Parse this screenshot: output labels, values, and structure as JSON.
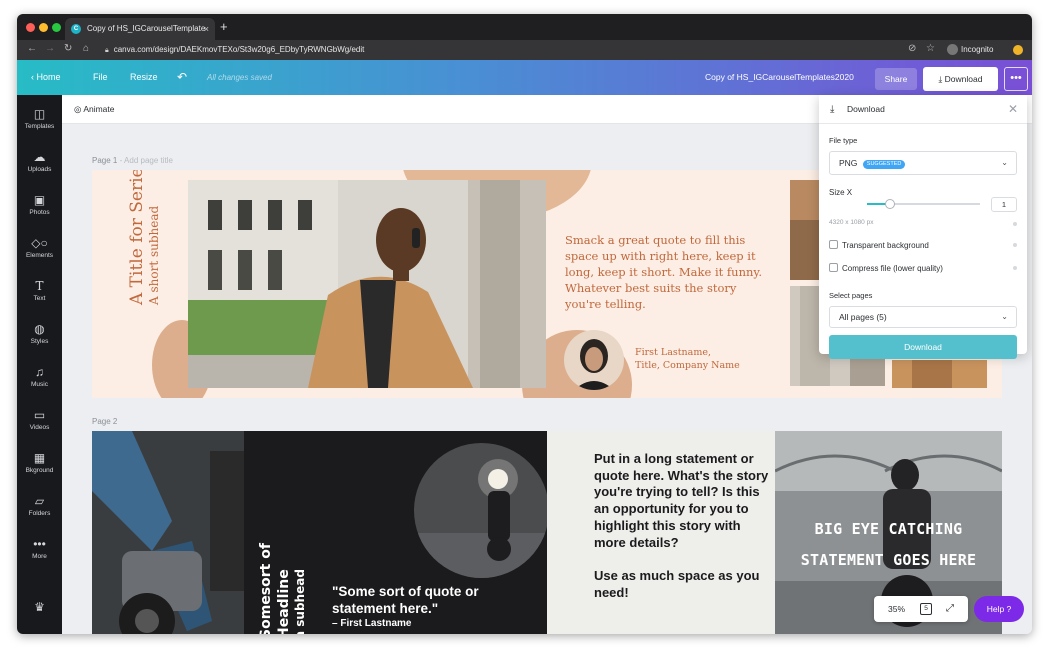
{
  "browser": {
    "tab_title": "Copy of HS_IGCarouselTemplate",
    "tab_close": "×",
    "new_tab": "+",
    "url": "canva.com/design/DAEKmovTEXo/St3w20g6_EDbyTyRWNGbWg/edit",
    "incognito_label": "Incognito"
  },
  "toolbar": {
    "home_label": "Home",
    "file_label": "File",
    "resize_label": "Resize",
    "saved_status": "All changes saved",
    "doc_title": "Copy of HS_IGCarouselTemplates2020",
    "share_label": "Share",
    "download_label": "Download",
    "more_label": "•••"
  },
  "sidebar": {
    "items": [
      {
        "label": "Templates",
        "icon": "templates-icon"
      },
      {
        "label": "Uploads",
        "icon": "uploads-icon"
      },
      {
        "label": "Photos",
        "icon": "photos-icon"
      },
      {
        "label": "Elements",
        "icon": "elements-icon"
      },
      {
        "label": "Text",
        "icon": "text-icon"
      },
      {
        "label": "Styles",
        "icon": "styles-icon"
      },
      {
        "label": "Music",
        "icon": "music-icon"
      },
      {
        "label": "Videos",
        "icon": "videos-icon"
      },
      {
        "label": "Bkground",
        "icon": "background-icon"
      },
      {
        "label": "Folders",
        "icon": "folders-icon"
      },
      {
        "label": "More",
        "icon": "more-icon"
      }
    ]
  },
  "subbar": {
    "animate_label": "Animate"
  },
  "page1": {
    "label": "Page 1",
    "title_hint": "- Add page title",
    "title": "A Title for Series",
    "subhead": "A short subhead",
    "quote": "Smack a great quote to fill this space up with right here, keep it long, keep it short. Make it funny. Whatever best suits the story you're telling.",
    "author_name": "First Lastname,",
    "author_title": "Title, Company Name"
  },
  "page2": {
    "label": "Page 2",
    "headline": "Somesort of Headline",
    "subhead": "a subhead",
    "quote": "\"Some sort of quote or statement here.\"",
    "quote_author": "– First Lastname",
    "statement": "Put in a long statement or quote here. What's the story you're trying to tell? Is this an opportunity for you to highlight this story with more details?",
    "statement_extra": "Use as much space as you need!",
    "big_statement_line1": "BIG EYE CATCHING",
    "big_statement_line2": "STATEMENT GOES HERE"
  },
  "zoom": {
    "level": "35%"
  },
  "help": {
    "label": "Help ?"
  },
  "download_panel": {
    "title": "Download",
    "file_type_label": "File type",
    "file_type_value": "PNG",
    "suggested_badge": "SUGGESTED",
    "size_label": "Size X",
    "size_value": "1",
    "size_slider_fraction": 0.2,
    "dimensions": "4320 x 1080 px",
    "transparent_label": "Transparent background",
    "compress_label": "Compress file (lower quality)",
    "select_pages_label": "Select pages",
    "pages_value": "All pages (5)",
    "download_button": "Download"
  },
  "colors": {
    "toolbar_start": "#27bcc6",
    "toolbar_end": "#7a4fd6",
    "accent_terracotta": "#c1683d",
    "page1_bg": "#fceee4",
    "download_button": "#54c0cd",
    "help_button": "#7d2ae8"
  }
}
